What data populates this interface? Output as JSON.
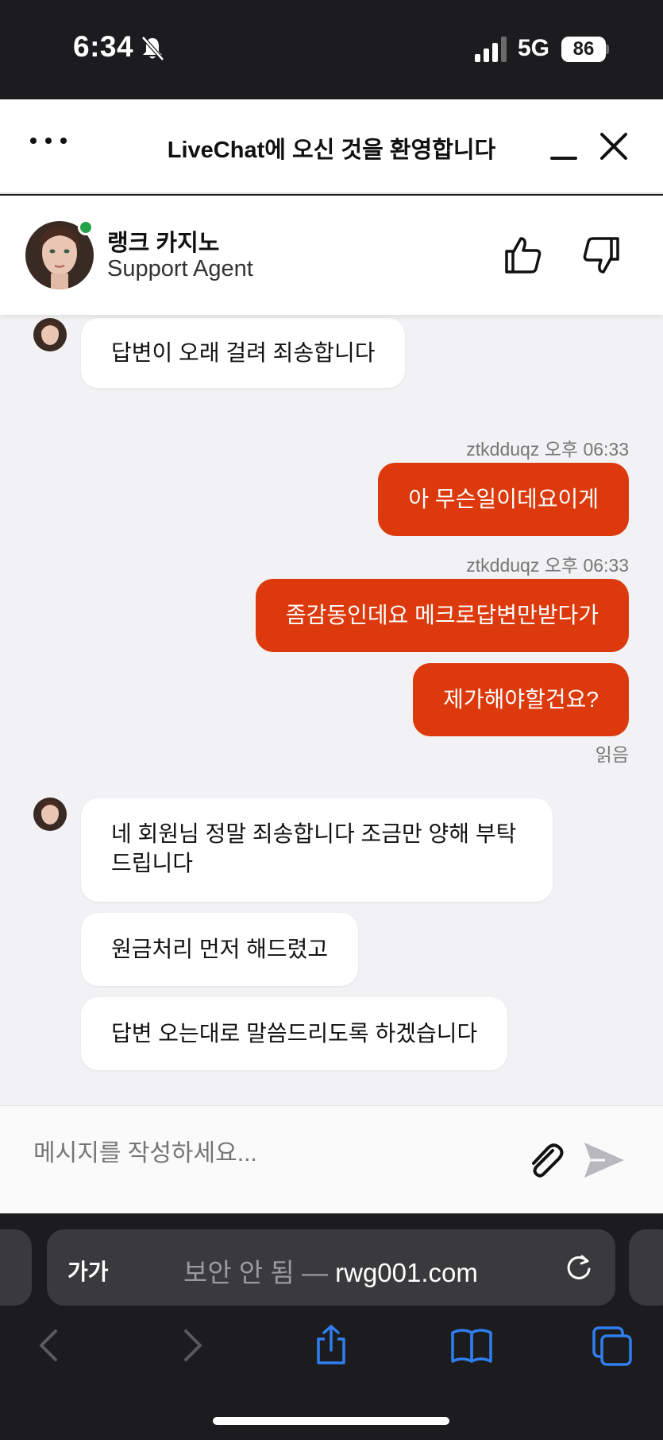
{
  "status_bar": {
    "time": "6:34",
    "network": "5G",
    "battery": "86"
  },
  "header": {
    "title": "LiveChat에 오신 것을 환영합니다"
  },
  "agent": {
    "name": "랭크 카지노",
    "role": "Support Agent"
  },
  "messages": {
    "m1": "답변이 오래 걸려 죄송합니다",
    "meta1": "ztkdduqz 오후 06:33",
    "m2": "아 무슨일이데요이게",
    "meta2": "ztkdduqz 오후 06:33",
    "m3": "좀감동인데요 메크로답변만받다가",
    "m4": "제가해야할건요?",
    "read_receipt": "읽음",
    "m5_line1": "네 회원님 정말 죄송합니다 조금만 양해 부탁",
    "m5_line2": "드립니다",
    "m6": "원금처리 먼저 해드렸고",
    "m7": "답변 오는대로 말씀드리도록 하겠습니다"
  },
  "composer": {
    "placeholder": "메시지를 작성하세요..."
  },
  "browser": {
    "aa": "가가",
    "insecure_label": "보안 안 됨 —",
    "domain": "rwg001.com"
  },
  "colors": {
    "accent": "#dc3a0c",
    "online": "#22a34a",
    "browser_icon": "#2f7ef0"
  }
}
